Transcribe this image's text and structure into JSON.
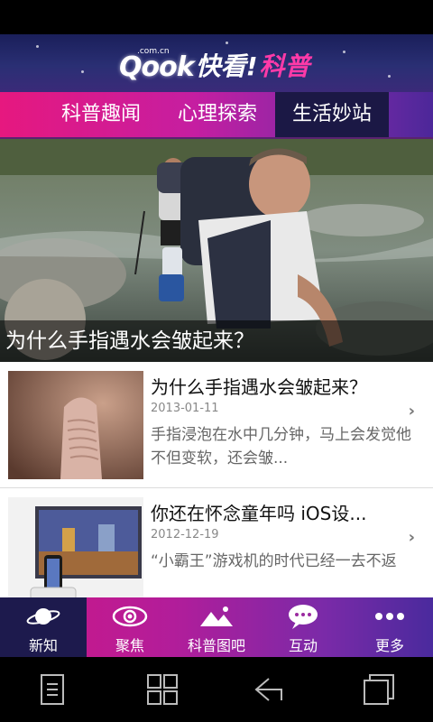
{
  "header": {
    "brand": "Qook",
    "domain": ".com.cn",
    "name_part1": "快看!",
    "name_part2": "科普"
  },
  "tabs": [
    {
      "label": "科普趣闻"
    },
    {
      "label": "心理探索"
    },
    {
      "label": "生活妙站",
      "active": true
    }
  ],
  "hero": {
    "caption": "为什么手指遇水会皱起来？"
  },
  "articles": [
    {
      "title": "为什么手指遇水会皱起来？",
      "date": "2013-01-11",
      "desc": "手指浸泡在水中几分钟，马上会发觉他不但变软，还会皱..."
    },
    {
      "title": "你还在怀念童年吗 iOS设...",
      "date": "2012-12-19",
      "desc": "“小霸王”游戏机的时代已经一去不返"
    }
  ],
  "bottom_nav": [
    {
      "label": "新知",
      "icon": "planet-icon",
      "active": true
    },
    {
      "label": "聚焦",
      "icon": "eye-icon"
    },
    {
      "label": "科普图吧",
      "icon": "mountain-icon"
    },
    {
      "label": "互动",
      "icon": "chat-bubble-icon"
    },
    {
      "label": "更多",
      "icon": "more-dots-icon"
    }
  ],
  "system_nav": [
    "menu-icon",
    "apps-grid-icon",
    "back-icon",
    "recents-icon"
  ],
  "colors": {
    "accent_pink": "#e6187f",
    "accent_purple": "#7a2aa8",
    "active_dark": "#1b1845"
  }
}
